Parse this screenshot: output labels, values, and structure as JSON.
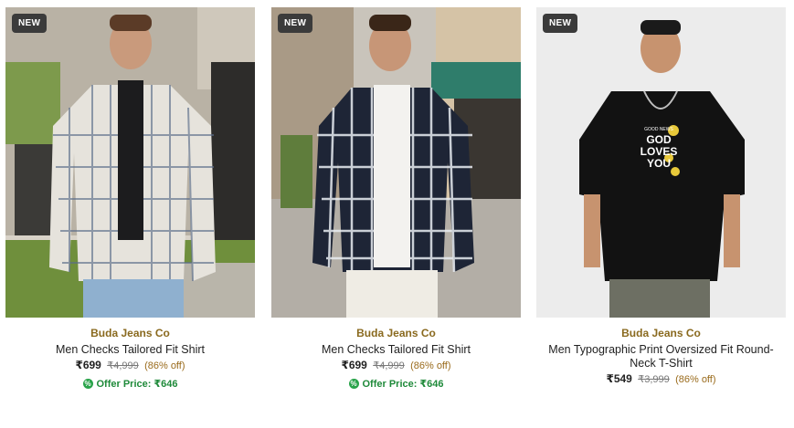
{
  "products": [
    {
      "badge": "NEW",
      "image_alt": "model-checked-shirt-grey",
      "brand": "Buda Jeans Co",
      "title": "Men Checks Tailored Fit Shirt",
      "price": "₹699",
      "mrp": "₹4,999",
      "discount": "(86% off)",
      "offer_price": "Offer Price: ₹646"
    },
    {
      "badge": "NEW",
      "image_alt": "model-checked-shirt-navy",
      "brand": "Buda Jeans Co",
      "title": "Men Checks Tailored Fit Shirt",
      "price": "₹699",
      "mrp": "₹4,999",
      "discount": "(86% off)",
      "offer_price": "Offer Price: ₹646"
    },
    {
      "badge": "NEW",
      "image_alt": "model-black-typographic-tshirt",
      "brand": "Buda Jeans Co",
      "title": "Men Typographic Print Oversized Fit Round-Neck T-Shirt",
      "price": "₹549",
      "mrp": "₹3,999",
      "discount": "(86% off)",
      "print_text": [
        "GOOD NEWS",
        "GOD",
        "LOVES",
        "YOU"
      ]
    }
  ],
  "colors": {
    "brand": "#8a6a1f",
    "offer": "#1f8a3a",
    "badge_bg": "#3b3b3b"
  }
}
